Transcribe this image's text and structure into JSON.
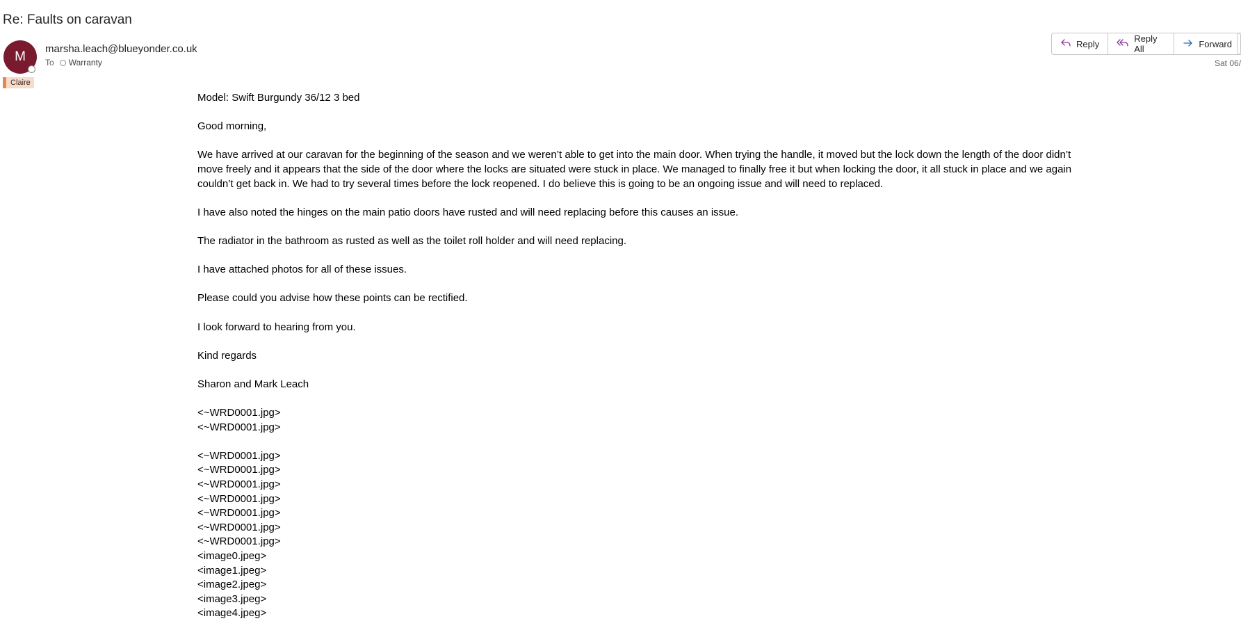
{
  "email": {
    "subject": "Re: Faults on caravan",
    "avatar_initial": "M",
    "avatar_color": "#7a1a2e",
    "sender": "marsha.leach@blueyonder.co.uk",
    "to_label": "To",
    "recipient": "Warranty",
    "category": "Claire",
    "category_color": "#e3894e",
    "date": "Sat 06/"
  },
  "actions": {
    "reply": "Reply",
    "reply_all": "Reply All",
    "forward": "Forward"
  },
  "icons": {
    "reply": "reply-icon",
    "reply_all": "reply-all-icon",
    "forward": "forward-icon",
    "presence": "presence-icon"
  },
  "body": {
    "model_line": "Model: Swift Burgundy 36/12 3 bed",
    "greeting": "Good morning,",
    "paragraph1": "We have arrived at our caravan for the beginning of the season and we weren’t able to get into the main door. When trying the handle, it moved but the lock down the length of the door didn’t move freely and it appears that the side of the door where the locks are situated were stuck in place. We managed to finally free it but when locking the door, it all stuck in place and we again couldn’t get back in. We had to try several times before the lock reopened. I do believe this is going to be an ongoing issue and will need to replaced.",
    "paragraph2": "I have also noted the hinges on the main patio doors have rusted and will need replacing before this causes an issue.",
    "paragraph3": "The radiator in the bathroom as rusted as well as the toilet roll holder and will need replacing.",
    "paragraph4": "I have attached photos for all of these issues.",
    "paragraph5": "Please could you advise how these points can be rectified.",
    "paragraph6": "I look forward to hearing from you.",
    "closing": "Kind regards",
    "signature": "Sharon and Mark Leach",
    "attachments_group1": [
      "<~WRD0001.jpg>",
      "<~WRD0001.jpg>"
    ],
    "attachments_group2": [
      "<~WRD0001.jpg>",
      "<~WRD0001.jpg>",
      "<~WRD0001.jpg>",
      "<~WRD0001.jpg>",
      "<~WRD0001.jpg>",
      "<~WRD0001.jpg>",
      "<~WRD0001.jpg>",
      "<image0.jpeg>",
      "<image1.jpeg>",
      "<image2.jpeg>",
      "<image3.jpeg>",
      "<image4.jpeg>"
    ]
  }
}
